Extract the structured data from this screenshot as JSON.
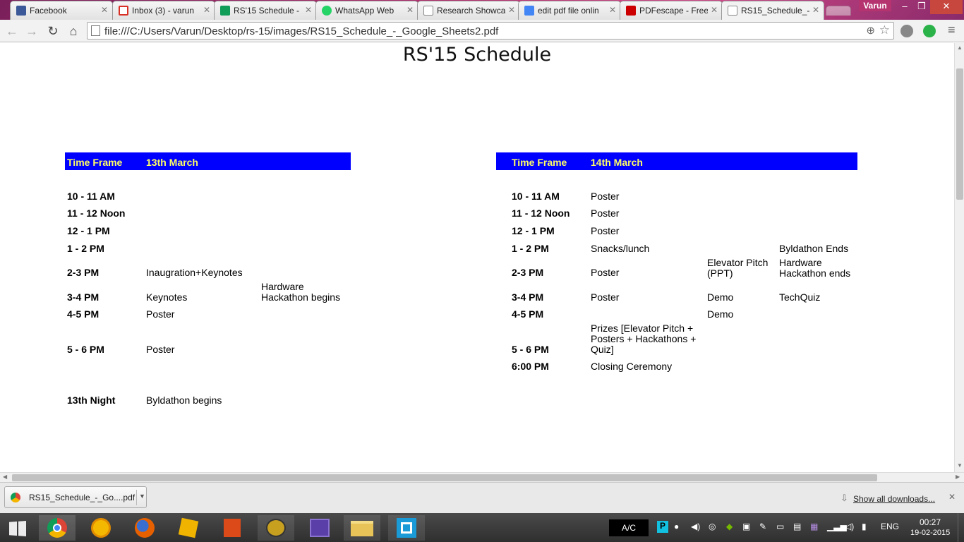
{
  "browser": {
    "tabs": [
      {
        "label": "Facebook",
        "icon": "facebook-icon",
        "color": "#3b5998"
      },
      {
        "label": "Inbox (3) - varun",
        "icon": "gmail-icon",
        "color": "#d93025"
      },
      {
        "label": "RS'15 Schedule -",
        "icon": "sheets-icon",
        "color": "#0f9d58"
      },
      {
        "label": "WhatsApp Web",
        "icon": "whatsapp-icon",
        "color": "#25d366"
      },
      {
        "label": "Research Showca",
        "icon": "page-icon",
        "color": "#888888"
      },
      {
        "label": "edit pdf file onlin",
        "icon": "google-icon",
        "color": "#4285f4"
      },
      {
        "label": "PDFescape - Free",
        "icon": "pdf-icon",
        "color": "#cc0000"
      },
      {
        "label": "RS15_Schedule_-",
        "icon": "page-icon",
        "color": "#888888"
      }
    ],
    "user": "Varun",
    "url": "file:///C:/Users/Varun/Desktop/rs-15/images/RS15_Schedule_-_Google_Sheets2.pdf"
  },
  "document": {
    "title": "RS'15 Schedule",
    "day1": {
      "header_time": "Time Frame",
      "header_day": "13th March",
      "rows": [
        {
          "time": "10 - 11 AM",
          "c1": "",
          "c2": ""
        },
        {
          "time": "11 - 12 Noon",
          "c1": "",
          "c2": ""
        },
        {
          "time": "12 - 1 PM",
          "c1": "",
          "c2": ""
        },
        {
          "time": "1 - 2 PM",
          "c1": "",
          "c2": ""
        },
        {
          "time": "2-3 PM",
          "c1": "Inaugration+Keynotes",
          "c2": ""
        },
        {
          "time": "3-4 PM",
          "c1": "Keynotes",
          "c2": "Hardware Hackathon begins"
        },
        {
          "time": "4-5 PM",
          "c1": "Poster",
          "c2": ""
        },
        {
          "time": "5 - 6 PM",
          "c1": "Poster",
          "c2": ""
        },
        {
          "time": "13th Night",
          "c1": "Byldathon begins",
          "c2": ""
        }
      ]
    },
    "day2": {
      "header_time": "Time Frame",
      "header_day": "14th March",
      "rows": [
        {
          "time": "10 - 11 AM",
          "c1": "Poster",
          "c2": "",
          "c3": ""
        },
        {
          "time": "11 - 12 Noon",
          "c1": "Poster",
          "c2": "",
          "c3": ""
        },
        {
          "time": "12 - 1 PM",
          "c1": "Poster",
          "c2": "",
          "c3": ""
        },
        {
          "time": "1 - 2 PM",
          "c1": "Snacks/lunch",
          "c2": "",
          "c3": "Byldathon Ends"
        },
        {
          "time": "2-3 PM",
          "c1": "Poster",
          "c2": "Elevator Pitch (PPT)",
          "c3": "Hardware Hackathon ends"
        },
        {
          "time": "3-4 PM",
          "c1": "Poster",
          "c2": "Demo",
          "c3": "TechQuiz"
        },
        {
          "time": "4-5 PM",
          "c1": "",
          "c2": "Demo",
          "c3": ""
        },
        {
          "time": "5 - 6 PM",
          "c1": "Prizes [Elevator Pitch + Posters + Hackathons + Quiz]",
          "c2": "",
          "c3": ""
        },
        {
          "time": "6:00 PM",
          "c1": "Closing Ceremony",
          "c2": "",
          "c3": ""
        }
      ]
    }
  },
  "downloads": {
    "file": "RS15_Schedule_-_Go....pdf",
    "show_all": "Show all downloads..."
  },
  "taskbar": {
    "pinned": [
      "start-icon",
      "chrome-icon",
      "app-circle-icon",
      "firefox-icon",
      "app-cube-icon",
      "office-icon",
      "app-globe-icon",
      "calendar-icon",
      "file-explorer-icon",
      "app-bracket-icon"
    ],
    "ac_label": "A/C",
    "language": "ENG",
    "time": "00:27",
    "date": "19-02-2015"
  },
  "colors": {
    "header_bg": "#0000ff",
    "header_text": "#ffff66"
  }
}
